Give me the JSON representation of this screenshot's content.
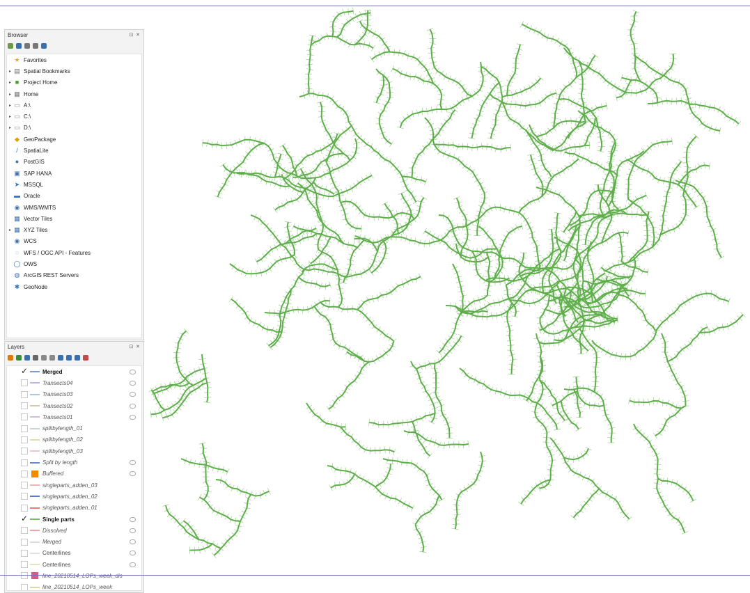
{
  "browser_panel": {
    "title": "Browser",
    "controls": "⊡ ✕",
    "items": [
      {
        "label": "Favorites",
        "icon": "star-icon",
        "color": "#e8b400",
        "expander": false
      },
      {
        "label": "Spatial Bookmarks",
        "icon": "bookmark-icon",
        "color": "#666666",
        "expander": true
      },
      {
        "label": "Project Home",
        "icon": "project-folder-icon",
        "color": "#4a9a2a",
        "expander": true
      },
      {
        "label": "Home",
        "icon": "home-icon",
        "color": "#777777",
        "expander": true
      },
      {
        "label": "A:\\",
        "icon": "drive-icon",
        "color": "#888888",
        "expander": true
      },
      {
        "label": "C:\\",
        "icon": "drive-icon",
        "color": "#888888",
        "expander": true
      },
      {
        "label": "D:\\",
        "icon": "drive-icon",
        "color": "#888888",
        "expander": true
      },
      {
        "label": "GeoPackage",
        "icon": "geopackage-icon",
        "color": "#d9a000",
        "expander": false
      },
      {
        "label": "SpatiaLite",
        "icon": "feather-icon",
        "color": "#3a6fb0",
        "expander": false
      },
      {
        "label": "PostGIS",
        "icon": "elephant-icon",
        "color": "#3a6fb0",
        "expander": false
      },
      {
        "label": "SAP HANA",
        "icon": "database-icon",
        "color": "#3a6fb0",
        "expander": false
      },
      {
        "label": "MSSQL",
        "icon": "mssql-icon",
        "color": "#3a6fb0",
        "expander": false
      },
      {
        "label": "Oracle",
        "icon": "oracle-icon",
        "color": "#3a6fb0",
        "expander": false
      },
      {
        "label": "WMS/WMTS",
        "icon": "globe-icon",
        "color": "#3a6fb0",
        "expander": false
      },
      {
        "label": "Vector Tiles",
        "icon": "grid-icon",
        "color": "#3a6fb0",
        "expander": false
      },
      {
        "label": "XYZ Tiles",
        "icon": "grid-icon",
        "color": "#3a6fb0",
        "expander": true
      },
      {
        "label": "WCS",
        "icon": "globe-icon",
        "color": "#3a6fb0",
        "expander": false
      },
      {
        "label": "WFS / OGC API - Features",
        "icon": "wfs-icon",
        "color": "#3a6fb0",
        "expander": false
      },
      {
        "label": "OWS",
        "icon": "ows-icon",
        "color": "#3a6fb0",
        "expander": false
      },
      {
        "label": "ArcGIS REST Servers",
        "icon": "arcgis-icon",
        "color": "#3a6fb0",
        "expander": false
      },
      {
        "label": "GeoNode",
        "icon": "geonode-icon",
        "color": "#3a6fb0",
        "expander": false
      }
    ]
  },
  "layers_panel": {
    "title": "Layers",
    "controls": "⊡ ✕",
    "toolbar_colors": [
      "#e07a00",
      "#3a8a3a",
      "#3a6fb0",
      "#666666",
      "#888888",
      "#888888",
      "#3a6fb0",
      "#3a6fb0",
      "#3a6fb0",
      "#c24a4a"
    ],
    "layers": [
      {
        "name": "Merged",
        "checked": true,
        "style": "bold",
        "symbol": "line",
        "color": "#7a9ad0",
        "eye": true
      },
      {
        "name": "Transects04",
        "checked": false,
        "style": "italic",
        "symbol": "line",
        "color": "#b8b8e8",
        "eye": true
      },
      {
        "name": "Transects03",
        "checked": false,
        "style": "italic",
        "symbol": "line",
        "color": "#a8c8e8",
        "eye": true
      },
      {
        "name": "Transects02",
        "checked": false,
        "style": "italic",
        "symbol": "line",
        "color": "#d8c8a8",
        "eye": true
      },
      {
        "name": "Transects01",
        "checked": false,
        "style": "italic",
        "symbol": "line",
        "color": "#d8b8e0",
        "eye": true
      },
      {
        "name": "splitbylength_01",
        "checked": false,
        "style": "italic",
        "symbol": "line",
        "color": "#c8d8c8",
        "eye": false
      },
      {
        "name": "splitbylength_02",
        "checked": false,
        "style": "italic",
        "symbol": "line",
        "color": "#e0e0a8",
        "eye": false
      },
      {
        "name": "splitbylength_03",
        "checked": false,
        "style": "italic",
        "symbol": "line",
        "color": "#e8c8d8",
        "eye": false
      },
      {
        "name": "Split by length",
        "checked": false,
        "style": "italic",
        "symbol": "line",
        "color": "#6a8ac8",
        "eye": true
      },
      {
        "name": "Buffered",
        "checked": false,
        "style": "italic",
        "symbol": "fill",
        "color": "#f08a00",
        "eye": true
      },
      {
        "name": "singleparts_adden_03",
        "checked": false,
        "style": "italic",
        "symbol": "line",
        "color": "#e8b8b8",
        "eye": false
      },
      {
        "name": "singleparts_adden_02",
        "checked": false,
        "style": "italic",
        "symbol": "line",
        "color": "#5a7ab8",
        "eye": false
      },
      {
        "name": "singleparts_adden_01",
        "checked": false,
        "style": "italic",
        "symbol": "line",
        "color": "#e87a7a",
        "eye": false
      },
      {
        "name": "Single parts",
        "checked": true,
        "style": "bold",
        "symbol": "line",
        "color": "#7ab86a",
        "eye": true
      },
      {
        "name": "Dissolved",
        "checked": false,
        "style": "italic",
        "symbol": "line",
        "color": "#e8a8a8",
        "eye": true
      },
      {
        "name": "Merged",
        "checked": false,
        "style": "italic",
        "symbol": "line",
        "color": "#d8d8e8",
        "eye": true
      },
      {
        "name": "Centerlines",
        "checked": false,
        "style": "plain",
        "symbol": "line",
        "color": "#e0e0e0",
        "eye": true
      },
      {
        "name": "Centerlines",
        "checked": false,
        "style": "plain",
        "symbol": "line",
        "color": "#e8e0b8",
        "eye": true
      },
      {
        "name": "line_20210514_LOPs_week_dis",
        "checked": false,
        "style": "italic",
        "symbol": "fill",
        "color": "#d85a8a",
        "eye": false
      },
      {
        "name": "line_20210514_LOPs_week",
        "checked": false,
        "style": "italic",
        "symbol": "line",
        "color": "#d8d8a8",
        "eye": false
      }
    ]
  },
  "map": {
    "line_color": "#5fae4c",
    "tick_color": "#a9d49b"
  }
}
